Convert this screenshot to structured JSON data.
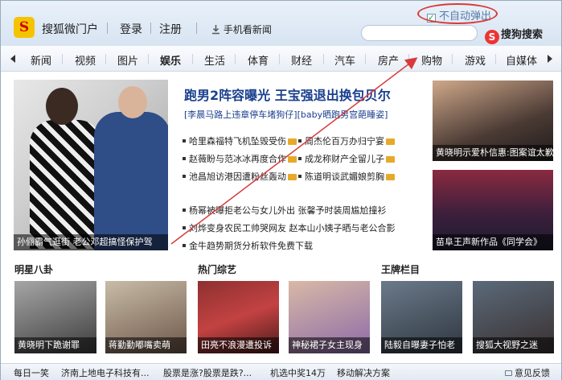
{
  "header": {
    "brand": "搜狐微门户",
    "login": "登录",
    "register": "注册",
    "mobile_news": "手机看新闻",
    "no_auto_popup": "不自动弹出",
    "sogou_search": "搜狗搜索"
  },
  "nav": {
    "items": [
      "新闻",
      "视频",
      "图片",
      "娱乐",
      "生活",
      "体育",
      "财经",
      "汽车",
      "房产",
      "购物",
      "游戏",
      "自媒体"
    ],
    "active_index": 3
  },
  "hero": {
    "caption": "孙俪霸气逛街 老公邓超搞怪保护驾"
  },
  "main": {
    "headline": "跑男2阵容曝光 王宝强退出换包贝尔",
    "subline": "[李晨马路上违章停车堵狗仔][baby晒跑男宫葩睡姿]",
    "pairs": [
      [
        "哈里森福特飞机坠毁受伤",
        "周杰伦百万办归宁宴"
      ],
      [
        "赵薇盼与范冰冰再度合作",
        "成龙称财产全留儿子"
      ],
      [
        "池昌旭访港因遭粉丝轰动",
        "陈道明谈武媚娘剪胸"
      ]
    ],
    "items": [
      "杨幂被曝拒老公与女儿外出 张馨予时装周尴尬撞衫",
      "刘烨变身农民工帅哭网友 赵本山小姨子晒与老公合影",
      "金牛趋势期货分析软件免费下载"
    ]
  },
  "right": {
    "thumb1_caption": "黄晓明示爱朴信惠:图案谊太歉",
    "thumb2_caption": "苗阜王声新作品《同学会》"
  },
  "sections": {
    "gossip_title": "明星八卦",
    "variety_title": "热门综艺",
    "brand_title": "王牌栏目",
    "thumbs": [
      "黄晓明下跪谢罪",
      "蒋勤勤嘟嘴卖萌",
      "田亮不浪漫遭投诉",
      "神秘裙子女主现身",
      "陆毅自曝妻子怕老",
      "搜狐大视野之迷"
    ]
  },
  "status": {
    "items": [
      "每日一笑",
      "济南上地电子科技有...",
      "股票是涨?股票是跌?...",
      "机选中奖14万",
      "移动解决方案"
    ],
    "feedback": "意见反馈"
  },
  "colors": {
    "link_blue": "#1a3f8e",
    "annotation_red": "#d83a3a"
  }
}
